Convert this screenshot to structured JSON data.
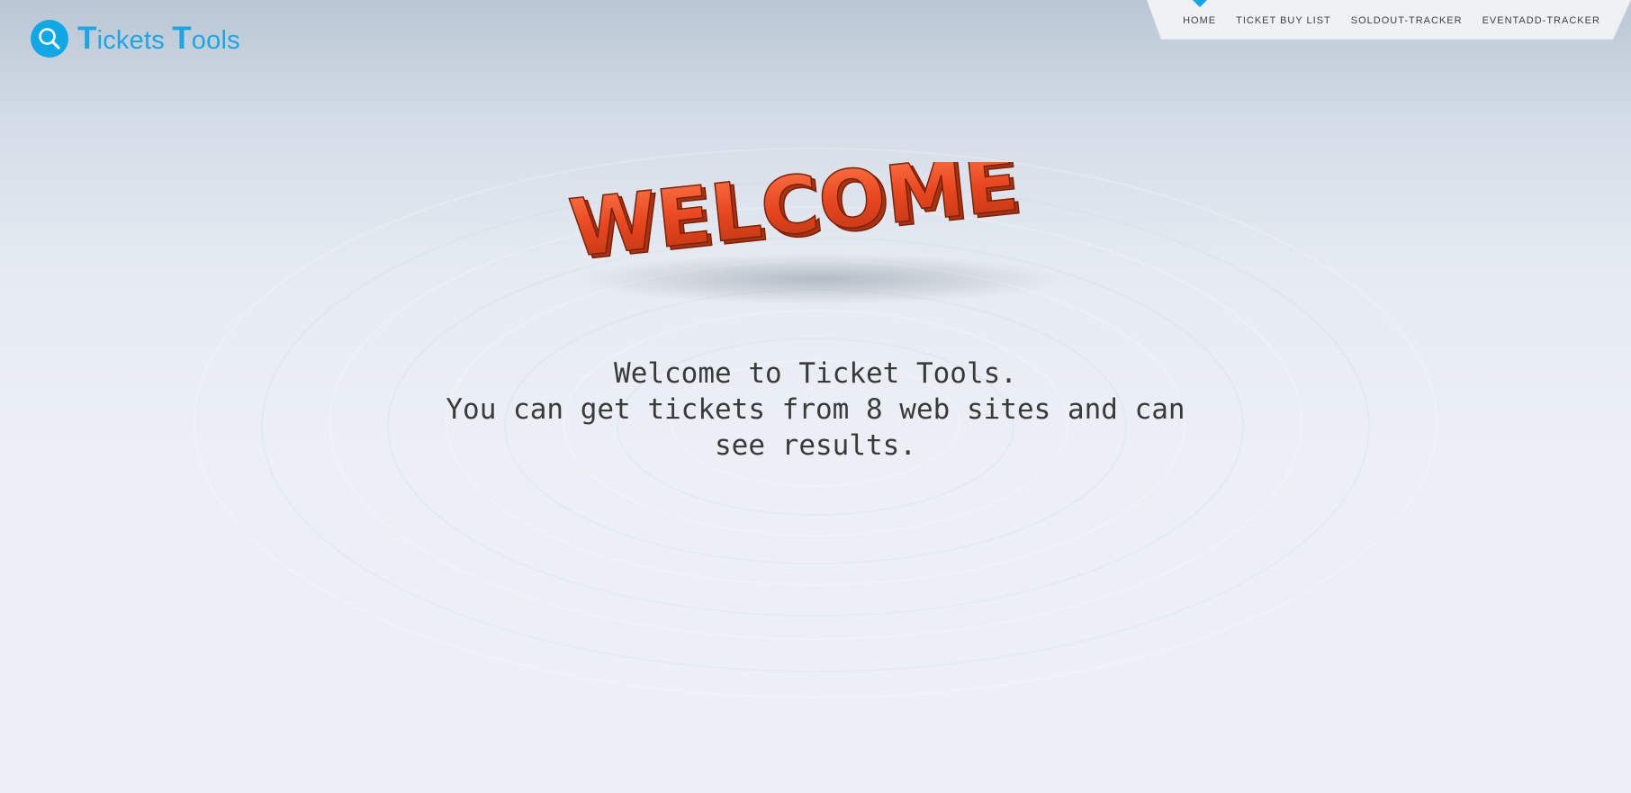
{
  "brand": {
    "name_parts": [
      "T",
      "ickets ",
      "T",
      "ools"
    ],
    "icon": "search-icon",
    "color": "#1ca7e2"
  },
  "nav": {
    "items": [
      {
        "label": "HOME",
        "active": true
      },
      {
        "label": "TICKET BUY LIST",
        "active": false
      },
      {
        "label": "SOLDOUT-TRACKER",
        "active": false
      },
      {
        "label": "EVENTADD-TRACKER",
        "active": false
      }
    ],
    "active_indicator_color": "#13a6e4"
  },
  "hero": {
    "art_text": "WELCOME",
    "art_color": "#e8471f"
  },
  "message": {
    "lines": [
      "Welcome to Ticket Tools.",
      "You can get tickets from 8 web sites and can",
      "see results."
    ]
  }
}
